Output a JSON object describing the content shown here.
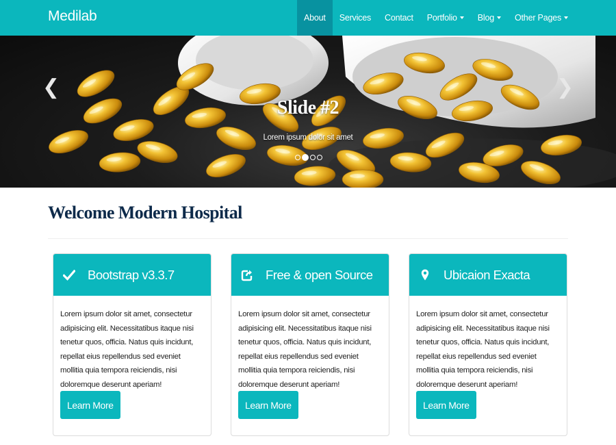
{
  "brand": "Medilab",
  "nav": {
    "about": "About",
    "services": "Services",
    "contact": "Contact",
    "portfolio": "Portfolio",
    "blog": "Blog",
    "other_pages": "Other Pages"
  },
  "carousel": {
    "title": "Slide #2",
    "caption": "Lorem ipsum dolor sit amet",
    "prev_icon": "chevron-left-icon",
    "next_icon": "chevron-right-icon",
    "active_index": 1,
    "indicator_count": 4
  },
  "welcome": {
    "heading": "Welcome Modern Hospital"
  },
  "features": [
    {
      "icon": "check-icon",
      "title": "Bootstrap v3.3.7",
      "text": "Lorem ipsum dolor sit amet, consectetur adipisicing elit. Necessitatibus itaque nisi tenetur quos, officia. Natus quis incidunt, repellat eius repellendus sed eveniet mollitia quia tempora reiciendis, nisi doloremque deserunt aperiam!",
      "button": "Learn More"
    },
    {
      "icon": "share-square-icon",
      "title": "Free & open Source",
      "text": "Lorem ipsum dolor sit amet, consectetur adipisicing elit. Necessitatibus itaque nisi tenetur quos, officia. Natus quis incidunt, repellat eius repellendus sed eveniet mollitia quia tempora reiciendis, nisi doloremque deserunt aperiam!",
      "button": "Learn More"
    },
    {
      "icon": "map-marker-icon",
      "title": "Ubicaion Exacta",
      "text": "Lorem ipsum dolor sit amet, consectetur adipisicing elit. Necessitatibus itaque nisi tenetur quos, officia. Natus quis incidunt, repellat eius repellendus sed eveniet mollitia quia tempora reiciendis, nisi doloremque deserunt aperiam!",
      "button": "Learn More"
    }
  ],
  "colors": {
    "accent": "#0bb7bd",
    "nav_active": "#0892a0",
    "heading": "#0d2a4a"
  }
}
